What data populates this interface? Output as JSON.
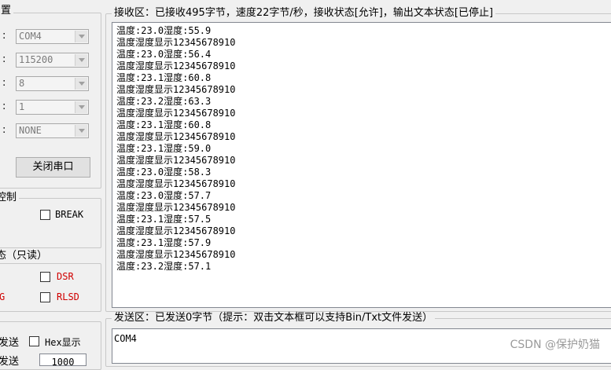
{
  "left_panel": {
    "settings_title": "置",
    "combos": [
      {
        "colon": ":",
        "value": "COM4"
      },
      {
        "colon": ":",
        "value": "115200"
      },
      {
        "colon": ":",
        "value": "8"
      },
      {
        "colon": ":",
        "value": "1"
      },
      {
        "colon": ":",
        "value": "NONE"
      }
    ],
    "close_port_label": "关闭串口",
    "control_title": "控制",
    "break_label": "BREAK",
    "status_title": "态（只读）",
    "dsr_label": "DSR",
    "cut_label": "G",
    "rlsd_label": "RLSD",
    "send_cut_label": "发送",
    "hex_display_label": "Hex显示",
    "cut_label2": "发送",
    "interval_value": "1000"
  },
  "receive": {
    "title": "接收区：已接收495字节，速度22字节/秒，接收状态[允许]，输出文本状态[已停止]",
    "lines": [
      "温度:23.0湿度:55.9",
      "温度湿度显示12345678910",
      "温度:23.0湿度:56.4",
      "温度湿度显示12345678910",
      "温度:23.1湿度:60.8",
      "温度湿度显示12345678910",
      "温度:23.2湿度:63.3",
      "温度湿度显示12345678910",
      "温度:23.1湿度:60.8",
      "温度湿度显示12345678910",
      "温度:23.1湿度:59.0",
      "温度湿度显示12345678910",
      "温度:23.0湿度:58.3",
      "温度湿度显示12345678910",
      "温度:23.0湿度:57.7",
      "温度湿度显示12345678910",
      "温度:23.1湿度:57.5",
      "温度湿度显示12345678910",
      "温度:23.1湿度:57.9",
      "温度湿度显示12345678910",
      "温度:23.2湿度:57.1"
    ]
  },
  "send": {
    "title": "发送区：已发送0字节（提示：双击文本框可以支持Bin/Txt文件发送）",
    "text": "COM4"
  },
  "watermark": "CSDN @保护奶猫"
}
